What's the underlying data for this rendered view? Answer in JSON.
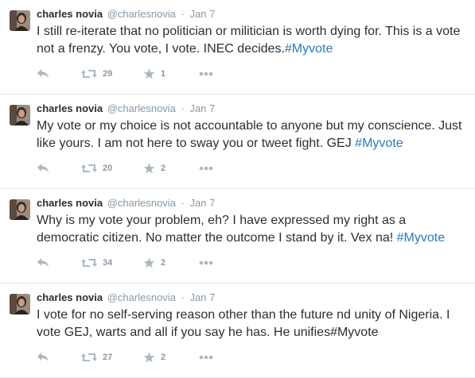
{
  "tweets": [
    {
      "author_name": "charles novia",
      "handle": "@charlesnovia",
      "separator": "·",
      "time": "Jan 7",
      "text": "I still re-iterate that no politician or militician is worth dying for. This is a vote not a frenzy. You vote, I vote. INEC decides.",
      "hashtag": "#Myvote",
      "retweets": "29",
      "favorites": "1"
    },
    {
      "author_name": "charles novia",
      "handle": "@charlesnovia",
      "separator": "·",
      "time": "Jan 7",
      "text": "My vote or my choice is not accountable to anyone but my conscience. Just like yours. I am not here to sway you or tweet fight. GEJ ",
      "hashtag": "#Myvote",
      "retweets": "20",
      "favorites": "2"
    },
    {
      "author_name": "charles novia",
      "handle": "@charlesnovia",
      "separator": "·",
      "time": "Jan 7",
      "text": "Why is my vote your problem, eh? I have expressed my right as a democratic citizen. No matter the outcome I stand by it. Vex na! ",
      "hashtag": "#Myvote",
      "retweets": "34",
      "favorites": "2"
    },
    {
      "author_name": "charles novia",
      "handle": "@charlesnovia",
      "separator": "·",
      "time": "Jan 7",
      "text": "I vote for no self-serving reason other than the future nd unity of Nigeria. I vote GEJ, warts and all if you say he has. He unifies#Myvote",
      "hashtag": "",
      "retweets": "27",
      "favorites": "2"
    }
  ],
  "icons": {
    "reply": "reply-icon",
    "retweet": "retweet-icon",
    "favorite": "star-icon",
    "more": "more-icon"
  },
  "colors": {
    "hashtag": "#2b7bb9",
    "meta": "#8899a6",
    "text": "#292f33",
    "divider": "#e1e8ed"
  }
}
